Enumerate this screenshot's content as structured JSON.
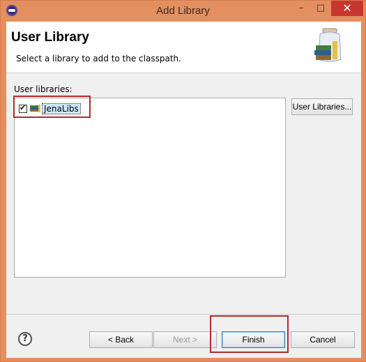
{
  "window": {
    "title": "Add Library"
  },
  "header": {
    "title": "User Library",
    "description": "Select a library to add to the classpath."
  },
  "section_label": "User libraries:",
  "libraries": [
    {
      "label": "JenaLibs",
      "checked": true
    }
  ],
  "buttons": {
    "user_libraries": "User Libraries...",
    "back": "< Back",
    "next": "Next >",
    "finish": "Finish",
    "cancel": "Cancel",
    "help": "?"
  },
  "controls": {
    "minimize": "–",
    "maximize": "□",
    "close": "✕"
  },
  "colors": {
    "titlebar": "#e48f5f",
    "close": "#c7372f",
    "highlight": "#b22b2b",
    "selection": "#cce8ff"
  },
  "icons": [
    "eclipse-icon",
    "library-jar-icon",
    "library-icon",
    "help-icon"
  ]
}
